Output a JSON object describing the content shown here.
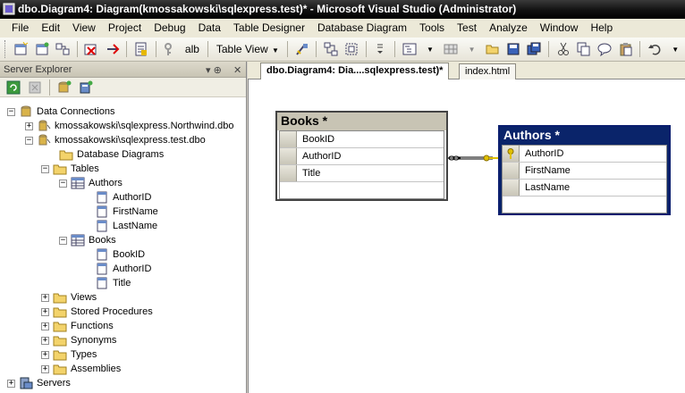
{
  "window": {
    "title": "dbo.Diagram4: Diagram(kmossakowski\\sqlexpress.test)* - Microsoft Visual Studio (Administrator)"
  },
  "menu": {
    "items": [
      "File",
      "Edit",
      "View",
      "Project",
      "Debug",
      "Data",
      "Table Designer",
      "Database Diagram",
      "Tools",
      "Test",
      "Analyze",
      "Window",
      "Help"
    ]
  },
  "toolbar": {
    "table_view_label": "Table View",
    "alb_label": "alb"
  },
  "server_explorer": {
    "title": "Server Explorer",
    "pin_glyph": "▾ ⊕",
    "close_glyph": "✕",
    "tree": {
      "data_connections": "Data Connections",
      "conn_northwind": "kmossakowski\\sqlexpress.Northwind.dbo",
      "conn_test": "kmossakowski\\sqlexpress.test.dbo",
      "database_diagrams": "Database Diagrams",
      "tables": "Tables",
      "authors": "Authors",
      "authors_cols": [
        "AuthorID",
        "FirstName",
        "LastName"
      ],
      "books": "Books",
      "books_cols": [
        "BookID",
        "AuthorID",
        "Title"
      ],
      "views": "Views",
      "stored_procedures": "Stored Procedures",
      "functions": "Functions",
      "synonyms": "Synonyms",
      "types": "Types",
      "assemblies": "Assemblies",
      "servers": "Servers"
    },
    "expanders": {
      "minus": "−",
      "plus": "+"
    }
  },
  "tabs": {
    "active": "dbo.Diagram4: Dia....sqlexpress.test)*",
    "second": "index.html"
  },
  "diagram": {
    "books": {
      "title": "Books *",
      "columns": [
        "BookID",
        "AuthorID",
        "Title"
      ]
    },
    "authors": {
      "title": "Authors *",
      "columns": [
        "AuthorID",
        "FirstName",
        "LastName"
      ]
    }
  },
  "colors": {
    "authors_header": "#0a246a",
    "books_header": "#c8c4b4",
    "key_icon": "#e0c000"
  }
}
